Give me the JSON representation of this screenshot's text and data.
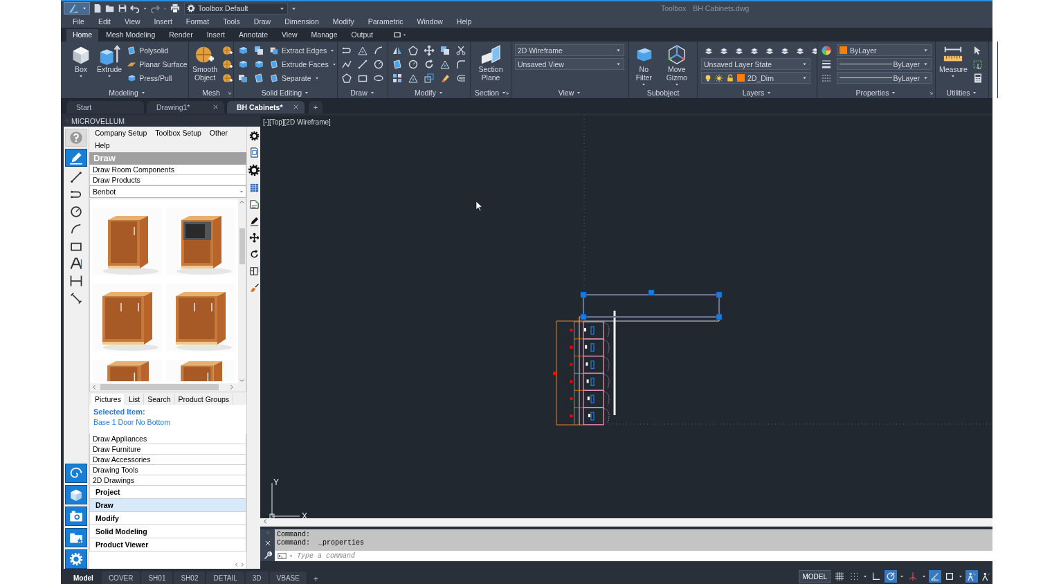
{
  "title_bar": {
    "workspace": "Toolbox Default",
    "app_name": "Toolbox",
    "file_name": "BH Cabinets.dwg"
  },
  "menu": [
    "File",
    "Edit",
    "View",
    "Insert",
    "Format",
    "Tools",
    "Draw",
    "Dimension",
    "Modify",
    "Parametric",
    "Window",
    "Help"
  ],
  "ribbon_tabs": [
    {
      "label": "Home",
      "selected": true
    },
    {
      "label": "Mesh Modeling",
      "selected": false
    },
    {
      "label": "Render",
      "selected": false
    },
    {
      "label": "Insert",
      "selected": false
    },
    {
      "label": "Annotate",
      "selected": false
    },
    {
      "label": "View",
      "selected": false
    },
    {
      "label": "Manage",
      "selected": false
    },
    {
      "label": "Output",
      "selected": false
    }
  ],
  "ribbon_panels": [
    {
      "title": "Modeling",
      "dropdown": true,
      "launcher": false,
      "columns": [
        {
          "kind": "large",
          "label": "Box",
          "menu": true
        },
        {
          "kind": "large",
          "label": "Extrude",
          "menu": true
        },
        {
          "kind": "small-list",
          "items": [
            {
              "label": "Polysolid",
              "menu": false
            },
            {
              "label": "Planar Surface",
              "menu": false
            },
            {
              "label": "Press/Pull",
              "menu": false
            }
          ]
        }
      ]
    },
    {
      "title": "Mesh",
      "dropdown": false,
      "launcher": true,
      "columns": [
        {
          "kind": "large",
          "label": "Smooth Object",
          "menu": false
        },
        {
          "kind": "icons"
        }
      ]
    },
    {
      "title": "Solid Editing",
      "dropdown": true,
      "launcher": false,
      "columns": [
        {
          "kind": "icons"
        },
        {
          "kind": "icons"
        },
        {
          "kind": "small-list",
          "items": [
            {
              "label": "Extract Edges",
              "menu": true
            },
            {
              "label": "Extrude Faces",
              "menu": true
            },
            {
              "label": "Separate",
              "menu": true
            }
          ]
        }
      ]
    },
    {
      "title": "Draw",
      "dropdown": true,
      "launcher": false,
      "columns": [
        {
          "kind": "icons"
        },
        {
          "kind": "icons"
        },
        {
          "kind": "icons"
        }
      ]
    },
    {
      "title": "Modify",
      "dropdown": true,
      "launcher": false,
      "columns": [
        {
          "kind": "icons"
        },
        {
          "kind": "icons"
        },
        {
          "kind": "icons"
        },
        {
          "kind": "icons"
        },
        {
          "kind": "icons"
        }
      ]
    },
    {
      "title": "Section",
      "dropdown": true,
      "launcher": true,
      "columns": [
        {
          "kind": "large",
          "label": "Section Plane",
          "menu": false
        }
      ]
    },
    {
      "title": "View",
      "dropdown": true,
      "launcher": false,
      "columns": [
        {
          "kind": "combos",
          "items": [
            {
              "kind": "combo",
              "value": "2D Wireframe"
            },
            {
              "kind": "combo",
              "value": "Unsaved View"
            }
          ]
        }
      ]
    },
    {
      "title": "Subobject",
      "dropdown": false,
      "launcher": false,
      "columns": [
        {
          "kind": "large",
          "label": "No Filter",
          "menu": true
        },
        {
          "kind": "large",
          "label": "Move Gizmo",
          "menu": true
        }
      ]
    },
    {
      "title": "Layers",
      "dropdown": true,
      "launcher": false,
      "columns": [
        {
          "kind": "combos",
          "items": [
            {
              "kind": "icon-row"
            },
            {
              "kind": "combo",
              "value": "Unsaved Layer State"
            },
            {
              "kind": "layer-combo",
              "value": "2D_Dim",
              "color": "#ff7f00"
            }
          ]
        }
      ]
    },
    {
      "title": "Properties",
      "dropdown": true,
      "launcher": true,
      "columns": [
        {
          "kind": "icons"
        },
        {
          "kind": "combos",
          "items": [
            {
              "kind": "color-combo",
              "value": "ByLayer",
              "color": "#ff7f00"
            },
            {
              "kind": "line-combo",
              "value": "ByLayer"
            },
            {
              "kind": "line-combo",
              "value": "ByLayer"
            }
          ]
        }
      ]
    },
    {
      "title": "Utilities",
      "dropdown": true,
      "launcher": false,
      "columns": [
        {
          "kind": "large",
          "label": "Measure",
          "menu": true
        },
        {
          "kind": "icons"
        }
      ]
    }
  ],
  "document_tabs": [
    {
      "label": "Start",
      "selected": false,
      "closable": false
    },
    {
      "label": "Drawing1*",
      "selected": false,
      "closable": true
    },
    {
      "label": "BH Cabinets*",
      "selected": true,
      "closable": true
    }
  ],
  "new_tab": "+",
  "palette": {
    "title": "MICROVELLUM",
    "mode_buttons": [
      {
        "selected": false
      },
      {
        "selected": true
      }
    ],
    "menu": [
      "Company Setup",
      "Toolbox Setup",
      "Other",
      "Help"
    ],
    "section": "Draw",
    "actions": [
      "Draw Room Components",
      "Draw Products"
    ],
    "library": {
      "value": "Benbot"
    },
    "thumbnails": [
      {
        "kind": "picture"
      },
      {
        "kind": "picture"
      },
      {
        "kind": "picture"
      },
      {
        "kind": "picture"
      },
      {
        "kind": "picture"
      },
      {
        "kind": "picture"
      }
    ],
    "view_tabs": [
      {
        "label": "Pictures",
        "selected": true
      },
      {
        "label": "List",
        "selected": false
      },
      {
        "label": "Search",
        "selected": false
      },
      {
        "label": "Product Groups",
        "selected": false
      }
    ],
    "selected_item": {
      "label": "Selected Item:",
      "value": "Base 1 Door No Bottom"
    },
    "more_actions": [
      "Draw Appliances",
      "Draw Furniture",
      "Draw Accessories",
      "Drawing Tools",
      "2D Drawings"
    ],
    "groups": [
      {
        "label": "Project",
        "selected": false
      },
      {
        "label": "Draw",
        "selected": true
      },
      {
        "label": "Modify",
        "selected": false
      },
      {
        "label": "Solid Modeling",
        "selected": false
      },
      {
        "label": "Product Viewer",
        "selected": false
      }
    ]
  },
  "viewport": {
    "label": "[-][Top][2D Wireframe]",
    "ucs": {
      "x": "X",
      "y": "Y"
    }
  },
  "command": {
    "history": [
      "Command:",
      "Command:  _properties"
    ],
    "placeholder": "Type a command"
  },
  "layout_tabs": [
    {
      "label": "Model",
      "selected": true
    },
    {
      "label": "COVER",
      "selected": false
    },
    {
      "label": "SH01",
      "selected": false
    },
    {
      "label": "SH02",
      "selected": false
    },
    {
      "label": "DETAIL",
      "selected": false
    },
    {
      "label": "3D",
      "selected": false
    },
    {
      "label": "VBASE",
      "selected": false
    }
  ],
  "new_layout": "+",
  "status": {
    "mode": "MODEL",
    "toggles": [
      {
        "on": false,
        "menu": false
      },
      {
        "on": false,
        "menu": true
      },
      {
        "on": false,
        "menu": false
      },
      {
        "on": true,
        "menu": true
      },
      {
        "on": false,
        "menu": true
      },
      {
        "on": true,
        "menu": false
      },
      {
        "on": false,
        "menu": true
      },
      {
        "on": true,
        "menu": false
      },
      {
        "on": false,
        "menu": false
      }
    ]
  }
}
